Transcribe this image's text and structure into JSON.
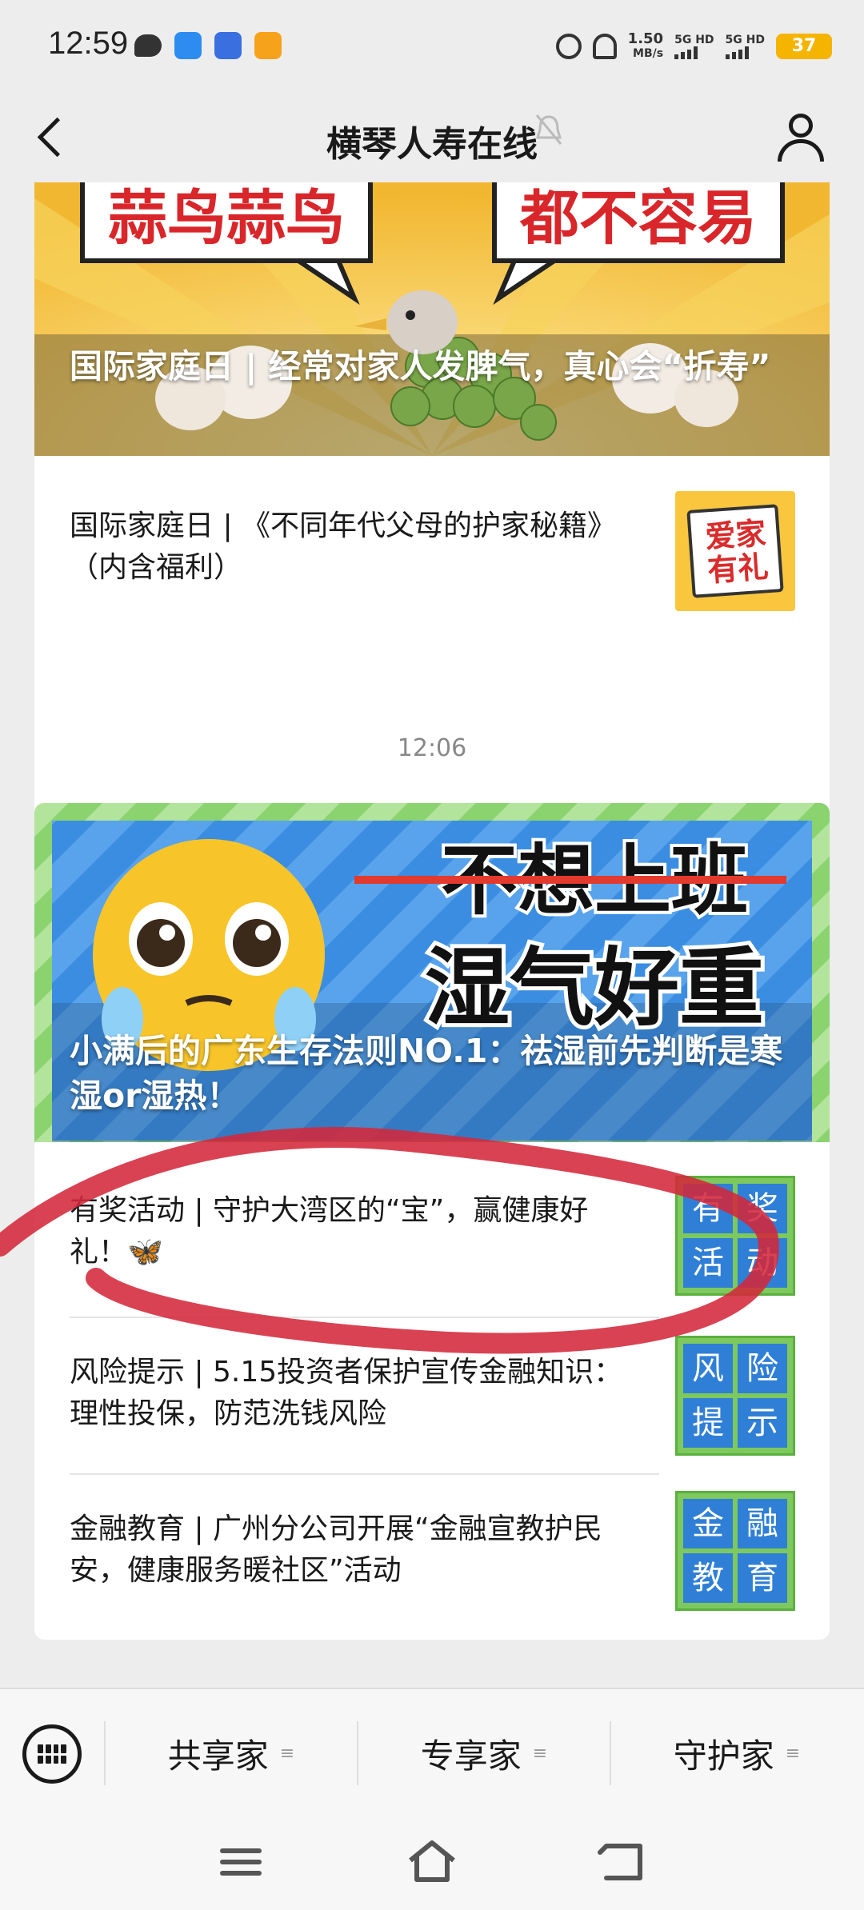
{
  "status_bar": {
    "time": "12:59",
    "net_speed_value": "1.50",
    "net_speed_unit": "MB/s",
    "sim1": "5G HD",
    "sim2": "5G HD",
    "battery": "37"
  },
  "header": {
    "title": "横琴人寿在线"
  },
  "feed": {
    "card1": {
      "hero_title": "国际家庭日 | 经常对家人发脾气，真心会“折寿”",
      "hero_banner_left": "蒜鸟蒜鸟",
      "hero_banner_right": "都不容易",
      "item": {
        "title": "国际家庭日 | 《不同年代父母的护家秘籍》（内含福利）",
        "thumb_text_1": "爱家",
        "thumb_text_2": "有礼"
      }
    },
    "timestamp": "12:06",
    "card2": {
      "hero_title": "小满后的广东生存法则NO.1：祛湿前先判断是寒湿or湿热！",
      "hero_struck_text": "不想上班",
      "hero_big_text": "湿气好重",
      "items": [
        {
          "title": "有奖活动 | 守护大湾区的“宝”，赢健康好礼！🦋",
          "thumb": [
            "有",
            "奖",
            "活",
            "动"
          ]
        },
        {
          "title": "风险提示 | 5.15投资者保护宣传金融知识：理性投保，防范洗钱风险",
          "thumb": [
            "风",
            "险",
            "提",
            "示"
          ]
        },
        {
          "title": "金融教育 | 广州分公司开展“金融宣教护民安，健康服务暖社区”活动",
          "thumb": [
            "金",
            "融",
            "教",
            "育"
          ]
        }
      ]
    }
  },
  "tab_bar": {
    "tabs": [
      {
        "label": "共享家"
      },
      {
        "label": "专享家"
      },
      {
        "label": "守护家"
      }
    ],
    "menu_mark": "≡"
  },
  "colors": {
    "background": "#ededed",
    "card": "#ffffff",
    "thumb_blue": "#2f7fd6",
    "thumb_green": "#7dc95e",
    "annotation_red": "#d4283a"
  }
}
